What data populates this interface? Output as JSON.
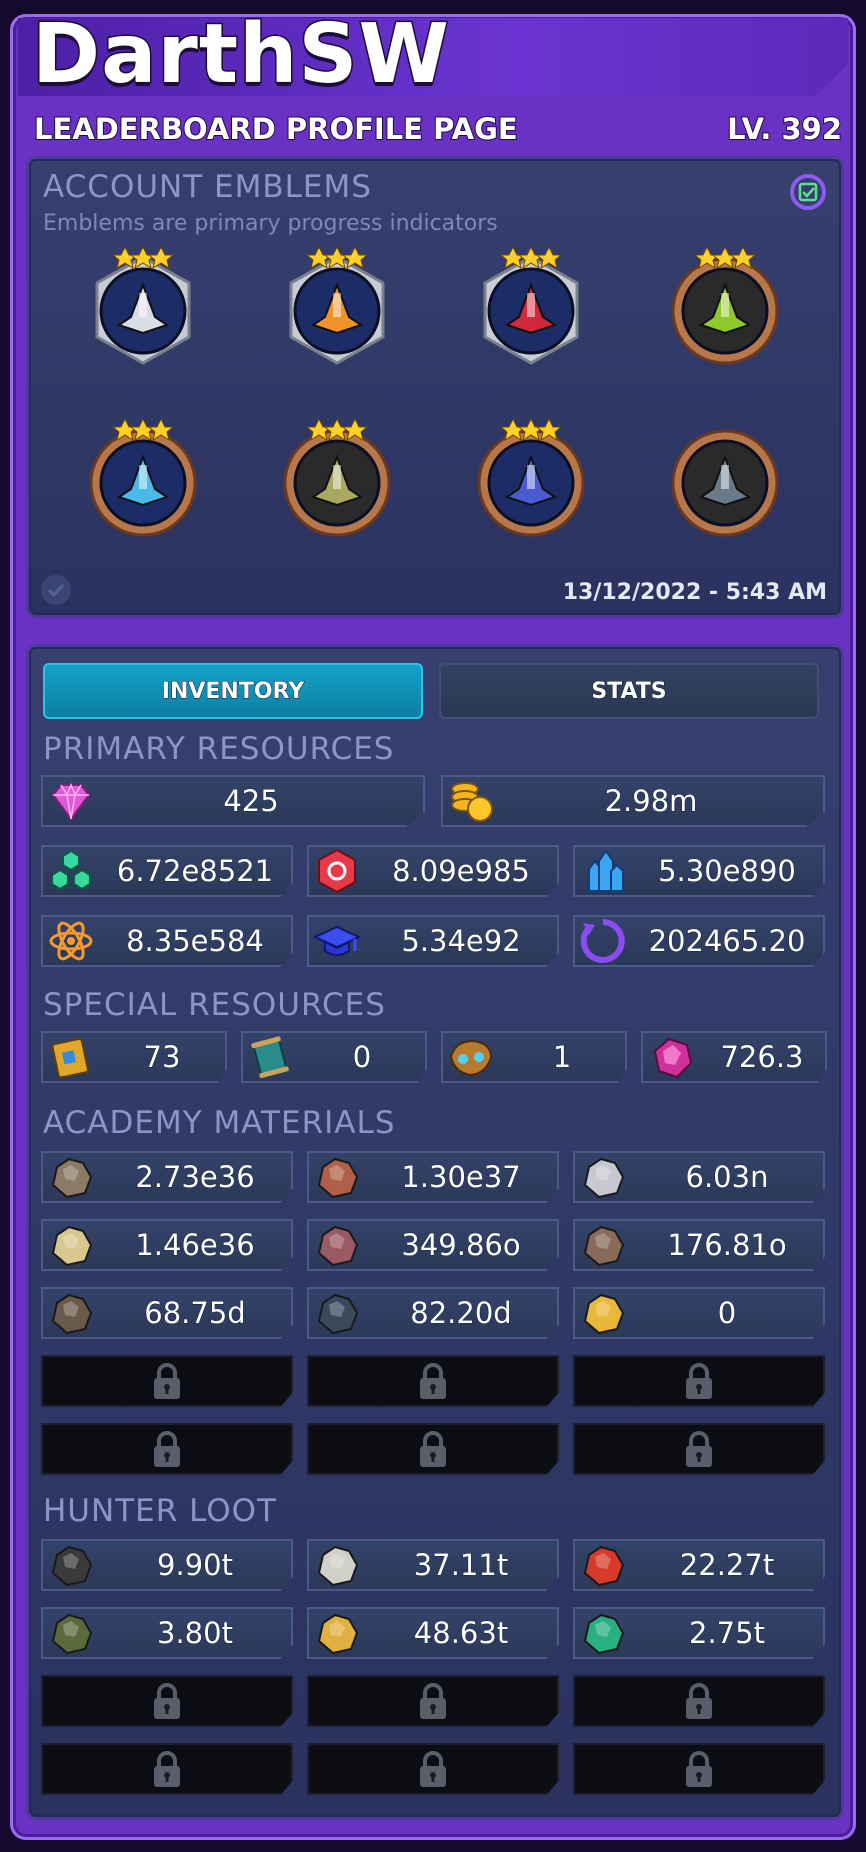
{
  "header": {
    "username": "DarthSW",
    "subtitle": "LEADERBOARD PROFILE PAGE",
    "level": "LV. 392"
  },
  "emblems": {
    "title": "ACCOUNT EMBLEMS",
    "subtitle": "Emblems are primary progress indicators",
    "timestamp": "13/12/2022 - 5:43 AM",
    "items": [
      {
        "name": "emblem-silver-1",
        "frame": "silver",
        "stars": 3
      },
      {
        "name": "emblem-silver-2",
        "frame": "silver",
        "stars": 3
      },
      {
        "name": "emblem-silver-3",
        "frame": "silver",
        "stars": 3
      },
      {
        "name": "emblem-bronze-1",
        "frame": "bronze",
        "stars": 3
      },
      {
        "name": "emblem-bronze-2",
        "frame": "bronze",
        "stars": 3
      },
      {
        "name": "emblem-bronze-3",
        "frame": "bronze",
        "stars": 3
      },
      {
        "name": "emblem-bronze-4",
        "frame": "bronze",
        "stars": 3
      },
      {
        "name": "emblem-bronze-5",
        "frame": "bronze",
        "stars": 0
      }
    ]
  },
  "tabs": {
    "inventory": "INVENTORY",
    "stats": "STATS"
  },
  "primary": {
    "title": "PRIMARY RESOURCES",
    "gems": "425",
    "coins": "2.98m",
    "row2": [
      "6.72e8521",
      "8.09e985",
      "5.30e890"
    ],
    "row3": [
      "8.35e584",
      "5.34e92",
      "202465.20"
    ]
  },
  "special": {
    "title": "SPECIAL RESOURCES",
    "values": [
      "73",
      "0",
      "1",
      "726.3"
    ]
  },
  "academy": {
    "title": "ACADEMY MATERIALS",
    "values": [
      "2.73e36",
      "1.30e37",
      "6.03n",
      "1.46e36",
      "349.86o",
      "176.81o",
      "68.75d",
      "82.20d",
      "0"
    ]
  },
  "hunter": {
    "title": "HUNTER LOOT",
    "values": [
      "9.90t",
      "37.11t",
      "22.27t",
      "3.80t",
      "48.63t",
      "2.75t"
    ]
  },
  "colors": {
    "accent_tab": "#15a2c8",
    "frame_purple": "#6a32c4",
    "panel": "#2f3764"
  }
}
